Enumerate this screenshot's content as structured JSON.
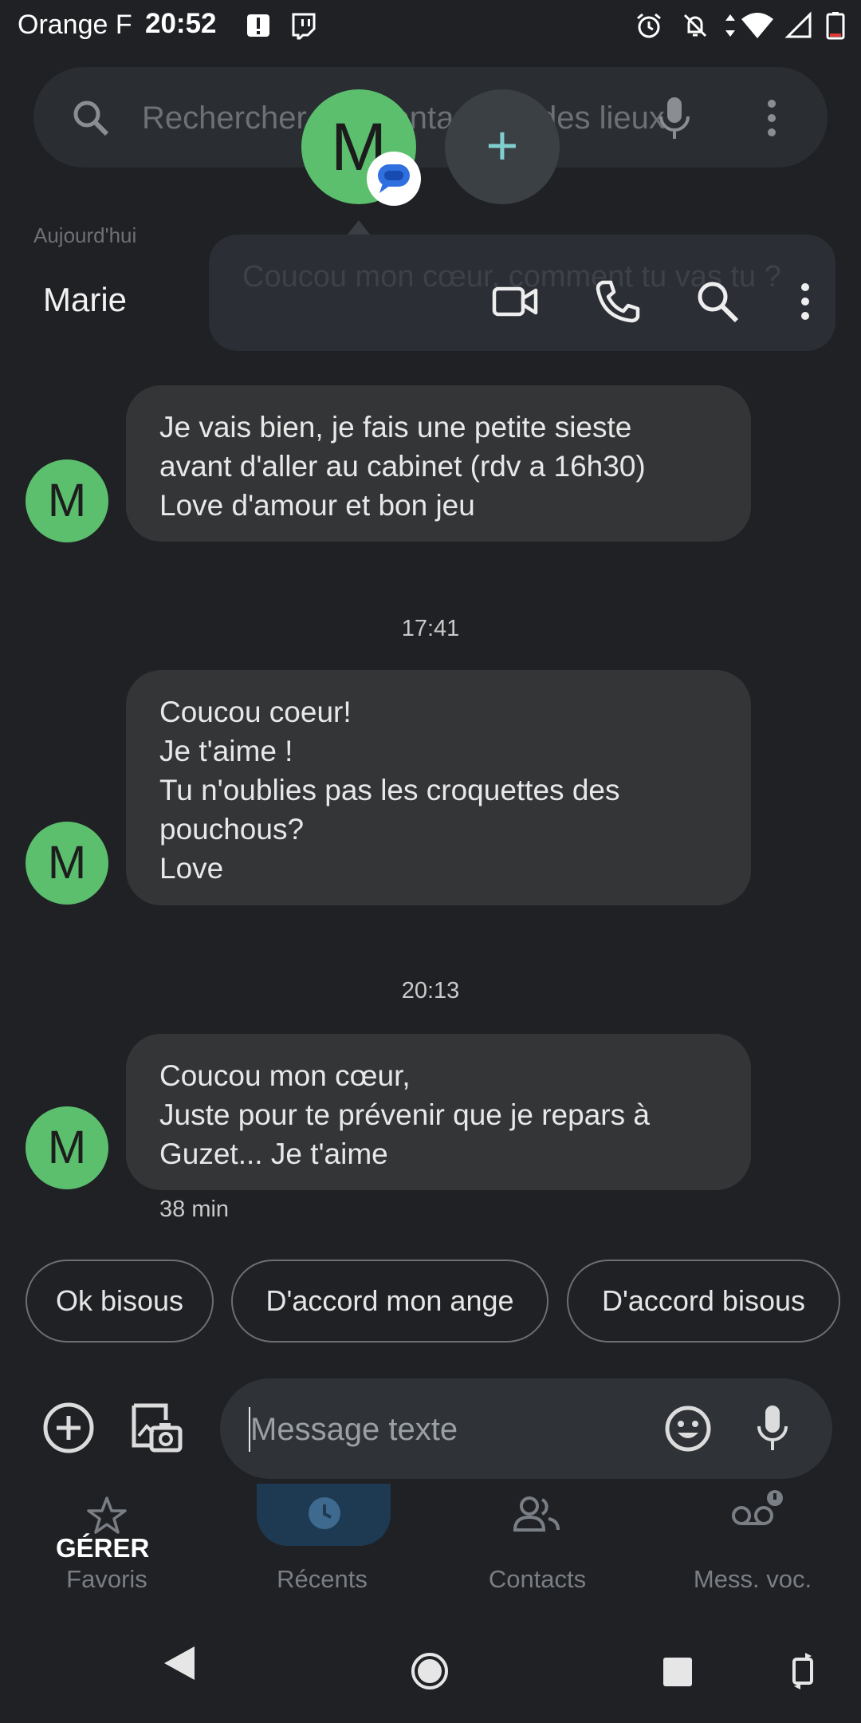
{
  "status_bar": {
    "carrier": "Orange F",
    "time": "20:52"
  },
  "background_app": {
    "search_placeholder": "Rechercher des contacts et des lieux",
    "section_today": "Aujourd'hui",
    "bubble_preview": "Coucou mon cœur, comment tu vas tu ?",
    "bubble_initial": "M",
    "nav": {
      "gerer": "GÉRER",
      "favoris": "Favoris",
      "recents": "Récents",
      "contacts": "Contacts",
      "messagerie": "Mess. voc."
    }
  },
  "conversation": {
    "contact_name": "Marie",
    "avatar_initial": "M",
    "messages": [
      {
        "lines": [
          "Je vais bien, je fais une petite sieste",
          "avant d'aller au cabinet (rdv a 16h30)",
          "Love d'amour et bon jeu"
        ]
      },
      {
        "timestamp": "17:41",
        "lines": [
          "Coucou coeur!",
          "Je t'aime !",
          "Tu n'oublies pas les croquettes des",
          "pouchous?",
          "Love"
        ]
      },
      {
        "timestamp": "20:13",
        "lines": [
          "Coucou mon cœur,",
          "Juste pour te prévenir que je repars à",
          "Guzet... Je t'aime"
        ],
        "age": "38 min"
      }
    ],
    "smart_replies": [
      "Ok bisous",
      "D'accord mon ange",
      "D'accord bisous"
    ],
    "composer_placeholder": "Message texte"
  },
  "colors": {
    "background": "#1f2125",
    "bubble": "#333537",
    "avatar": "#5bbf6e",
    "composer": "#2f3236"
  }
}
